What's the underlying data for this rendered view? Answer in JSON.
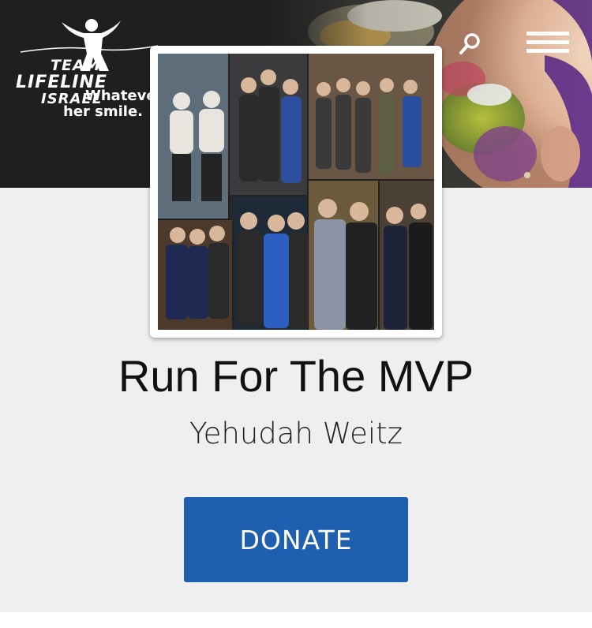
{
  "header": {
    "logo": {
      "line1": "TEAM",
      "line2": "LIFELINE",
      "line3": "ISRAEL",
      "alt_icon": "runner-logo-icon"
    },
    "tagline": {
      "line1": "Whatever",
      "line2": "her smile."
    },
    "search_icon": "search-icon",
    "menu_icon": "hamburger-menu-icon"
  },
  "profile": {
    "photo_icon": "group-photo-collage",
    "title": "Run For The MVP",
    "name": "Yehudah Weitz"
  },
  "actions": {
    "donate_label": "DONATE"
  },
  "colors": {
    "header_bg": "#1f1f1f",
    "page_bg": "#efeff0",
    "donate_bg": "#1f5fb0",
    "donate_text": "#ffffff"
  }
}
